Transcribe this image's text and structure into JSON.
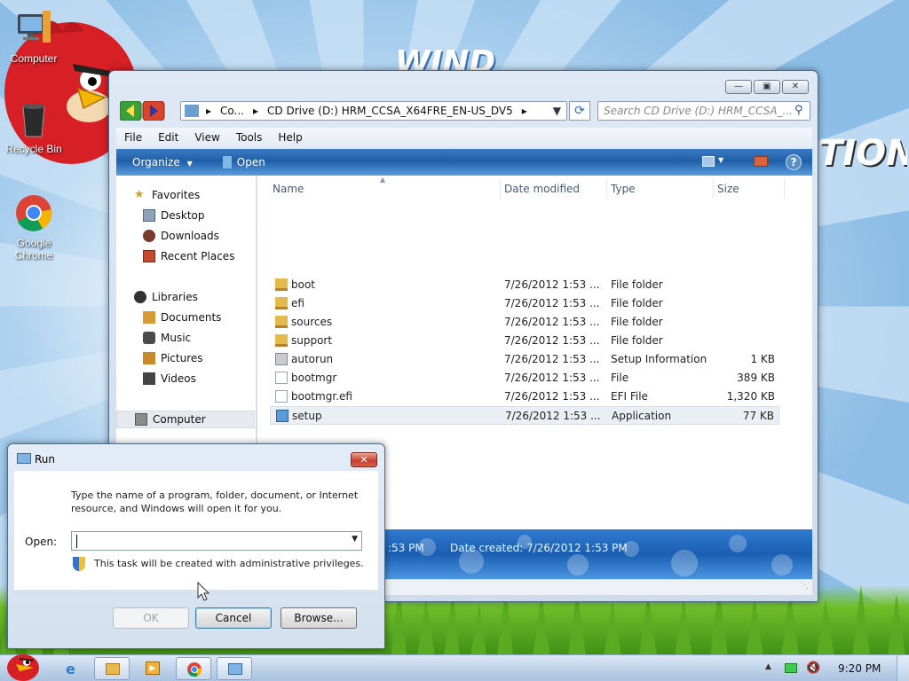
{
  "desktop": {
    "icons": [
      {
        "label": "Computer"
      },
      {
        "label": "Recycle Bin"
      },
      {
        "label": "Google Chrome"
      }
    ]
  },
  "explorer": {
    "address": {
      "crumb1": "Co...",
      "crumb2": "CD Drive (D:) HRM_CCSA_X64FRE_EN-US_DV5"
    },
    "search": {
      "placeholder": "Search CD Drive (D:) HRM_CCSA_..."
    },
    "menu": [
      "File",
      "Edit",
      "View",
      "Tools",
      "Help"
    ],
    "toolbar": {
      "organize": "Organize",
      "open": "Open"
    },
    "nav": {
      "favorites": "Favorites",
      "desktop": "Desktop",
      "downloads": "Downloads",
      "recent": "Recent Places",
      "libraries": "Libraries",
      "documents": "Documents",
      "music": "Music",
      "pictures": "Pictures",
      "videos": "Videos",
      "computer": "Computer"
    },
    "columns": {
      "name": "Name",
      "date": "Date modified",
      "type": "Type",
      "size": "Size"
    },
    "files": [
      {
        "name": "boot",
        "date": "7/26/2012 1:53 ...",
        "type": "File folder",
        "size": "",
        "icon": "folder-icon"
      },
      {
        "name": "efi",
        "date": "7/26/2012 1:53 ...",
        "type": "File folder",
        "size": "",
        "icon": "folder-icon"
      },
      {
        "name": "sources",
        "date": "7/26/2012 1:53 ...",
        "type": "File folder",
        "size": "",
        "icon": "folder-icon"
      },
      {
        "name": "support",
        "date": "7/26/2012 1:53 ...",
        "type": "File folder",
        "size": "",
        "icon": "folder-icon"
      },
      {
        "name": "autorun",
        "date": "7/26/2012 1:53 ...",
        "type": "Setup Information",
        "size": "1 KB",
        "icon": "settings-file-icon"
      },
      {
        "name": "bootmgr",
        "date": "7/26/2012 1:53 ...",
        "type": "File",
        "size": "389 KB",
        "icon": "file-icon"
      },
      {
        "name": "bootmgr.efi",
        "date": "7/26/2012 1:53 ...",
        "type": "EFI File",
        "size": "1,320 KB",
        "icon": "file-icon"
      },
      {
        "name": "setup",
        "date": "7/26/2012 1:53 ...",
        "type": "Application",
        "size": "77 KB",
        "icon": "app-icon"
      }
    ],
    "details": {
      "modified_partial": ":53 PM",
      "created": "Date created: 7/26/2012 1:53 PM"
    }
  },
  "run_dialog": {
    "title": "Run",
    "description": "Type the name of a program, folder, document, or Internet resource, and Windows will open it for you.",
    "open_label": "Open:",
    "input_value": "",
    "note": "This task will be created with administrative privileges.",
    "ok": "OK",
    "cancel": "Cancel",
    "browse": "Browse..."
  },
  "taskbar": {
    "clock": "9:20 PM"
  },
  "wallpaper": {
    "text1": "WIND",
    "text2": "TION"
  },
  "colors": {
    "accent": "#1f5ea8",
    "selection": "#ebeef3"
  }
}
